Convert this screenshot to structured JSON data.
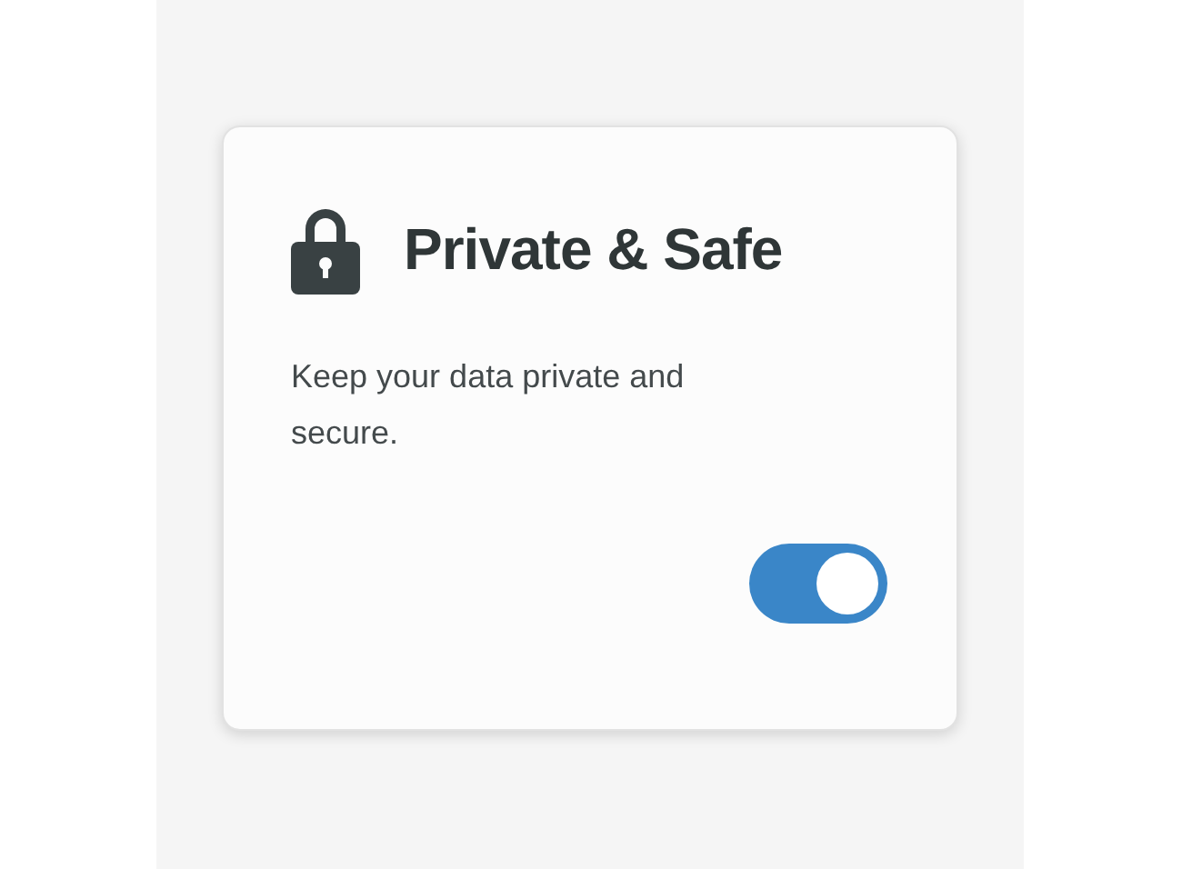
{
  "card": {
    "title": "Private & Safe",
    "description": "Keep your data private and secure.",
    "toggle": {
      "on": true
    }
  }
}
